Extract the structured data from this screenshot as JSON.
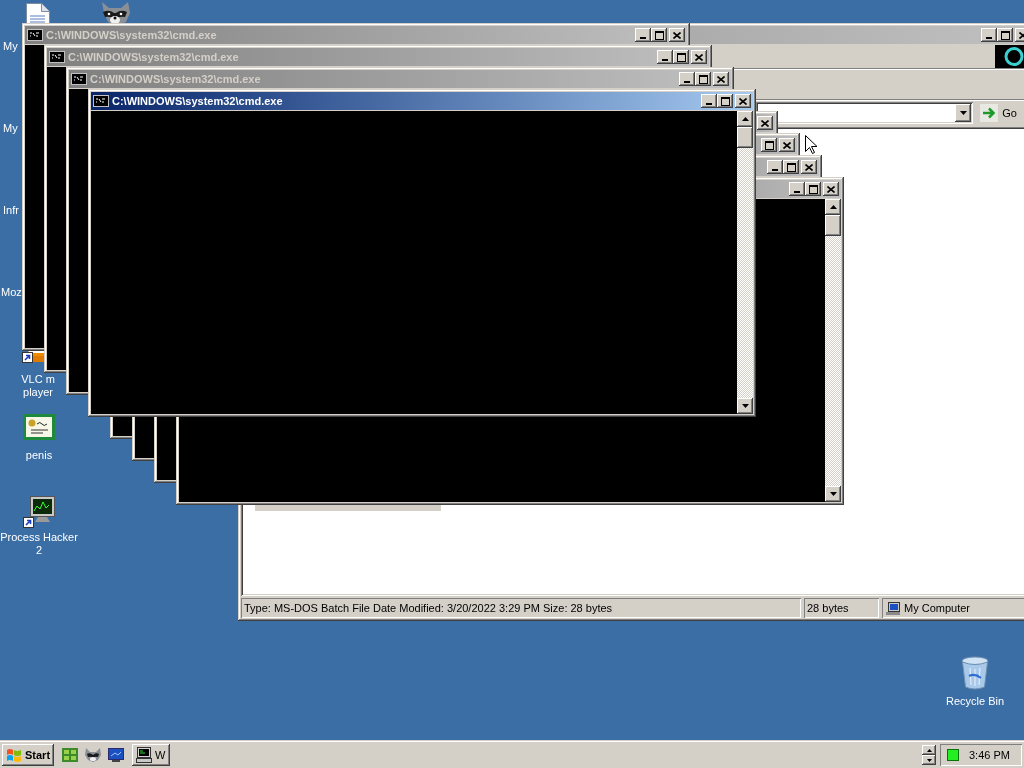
{
  "desktop_icons": [
    {
      "kind": "document",
      "label_lines": [
        "My"
      ]
    },
    {
      "kind": "raccoon"
    },
    {
      "kind": "hidden",
      "label_lines": [
        "My"
      ]
    },
    {
      "kind": "hidden",
      "label_lines": [
        "Infr"
      ]
    },
    {
      "kind": "hidden",
      "label_lines": [
        "Moz"
      ]
    },
    {
      "kind": "traffic_cone",
      "label_lines": [
        "VLC m",
        "player"
      ]
    },
    {
      "kind": "certificate",
      "label_lines": [
        "penis"
      ]
    },
    {
      "kind": "monitor_chart",
      "label_lines": [
        "Process Hacker",
        "2"
      ]
    },
    {
      "kind": "recycle_bin",
      "label_lines": [
        "Recycle Bin"
      ]
    }
  ],
  "explorer_window": {
    "active": false,
    "go_button": "Go",
    "status_bar": {
      "details": "Type: MS-DOS Batch File Date Modified: 3/20/2022 3:29 PM Size: 28 bytes",
      "size": "28 bytes",
      "location": "My Computer"
    }
  },
  "console_windows": [
    {
      "title": "C:\\WINDOWS\\system32\\cmd.exe",
      "active": false
    },
    {
      "title": "C:\\WINDOWS\\system32\\cmd.exe",
      "active": false
    },
    {
      "title": "C:\\WINDOWS\\system32\\cmd.exe",
      "active": false
    },
    {
      "title": "C:\\WINDOWS\\system32\\cmd.exe",
      "active": true
    },
    {
      "active": false
    },
    {
      "active": false
    },
    {
      "active": false
    },
    {
      "active": false
    }
  ],
  "taskbar": {
    "start_button": "Start",
    "quick_launch": [
      {
        "kind": "tiles"
      },
      {
        "kind": "raccoon"
      },
      {
        "kind": "monitor"
      }
    ],
    "tasks": [
      {
        "label": "W",
        "selected": false
      }
    ],
    "clock": "3:46 PM"
  }
}
